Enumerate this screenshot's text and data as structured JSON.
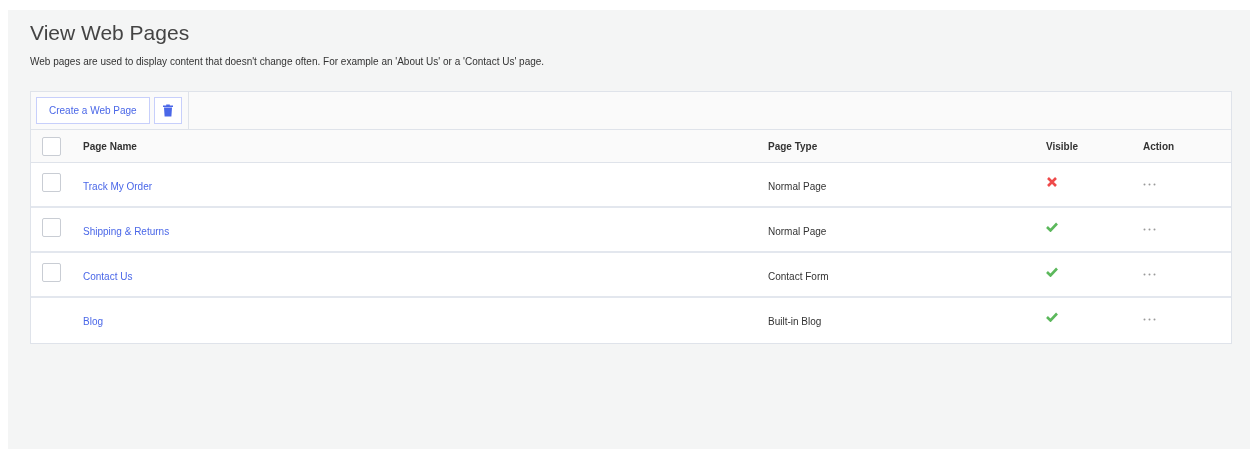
{
  "title": "View Web Pages",
  "description": "Web pages are used to display content that doesn't change often. For example an 'About Us' or a 'Contact Us' page.",
  "toolbar": {
    "create_button": "Create a Web Page"
  },
  "table": {
    "select_all": {
      "checked": false
    },
    "columns": [
      "Page Name",
      "Page Type",
      "Visible",
      "Action"
    ],
    "rows": [
      {
        "name": "Track My Order",
        "type": "Normal Page",
        "visible": false,
        "selectable": true,
        "checked": false
      },
      {
        "name": "Shipping & Returns",
        "type": "Normal Page",
        "visible": true,
        "selectable": true,
        "checked": false
      },
      {
        "name": "Contact Us",
        "type": "Contact Form",
        "visible": true,
        "selectable": true,
        "checked": false
      },
      {
        "name": "Blog",
        "type": "Built-in Blog",
        "visible": true,
        "selectable": false
      }
    ]
  }
}
